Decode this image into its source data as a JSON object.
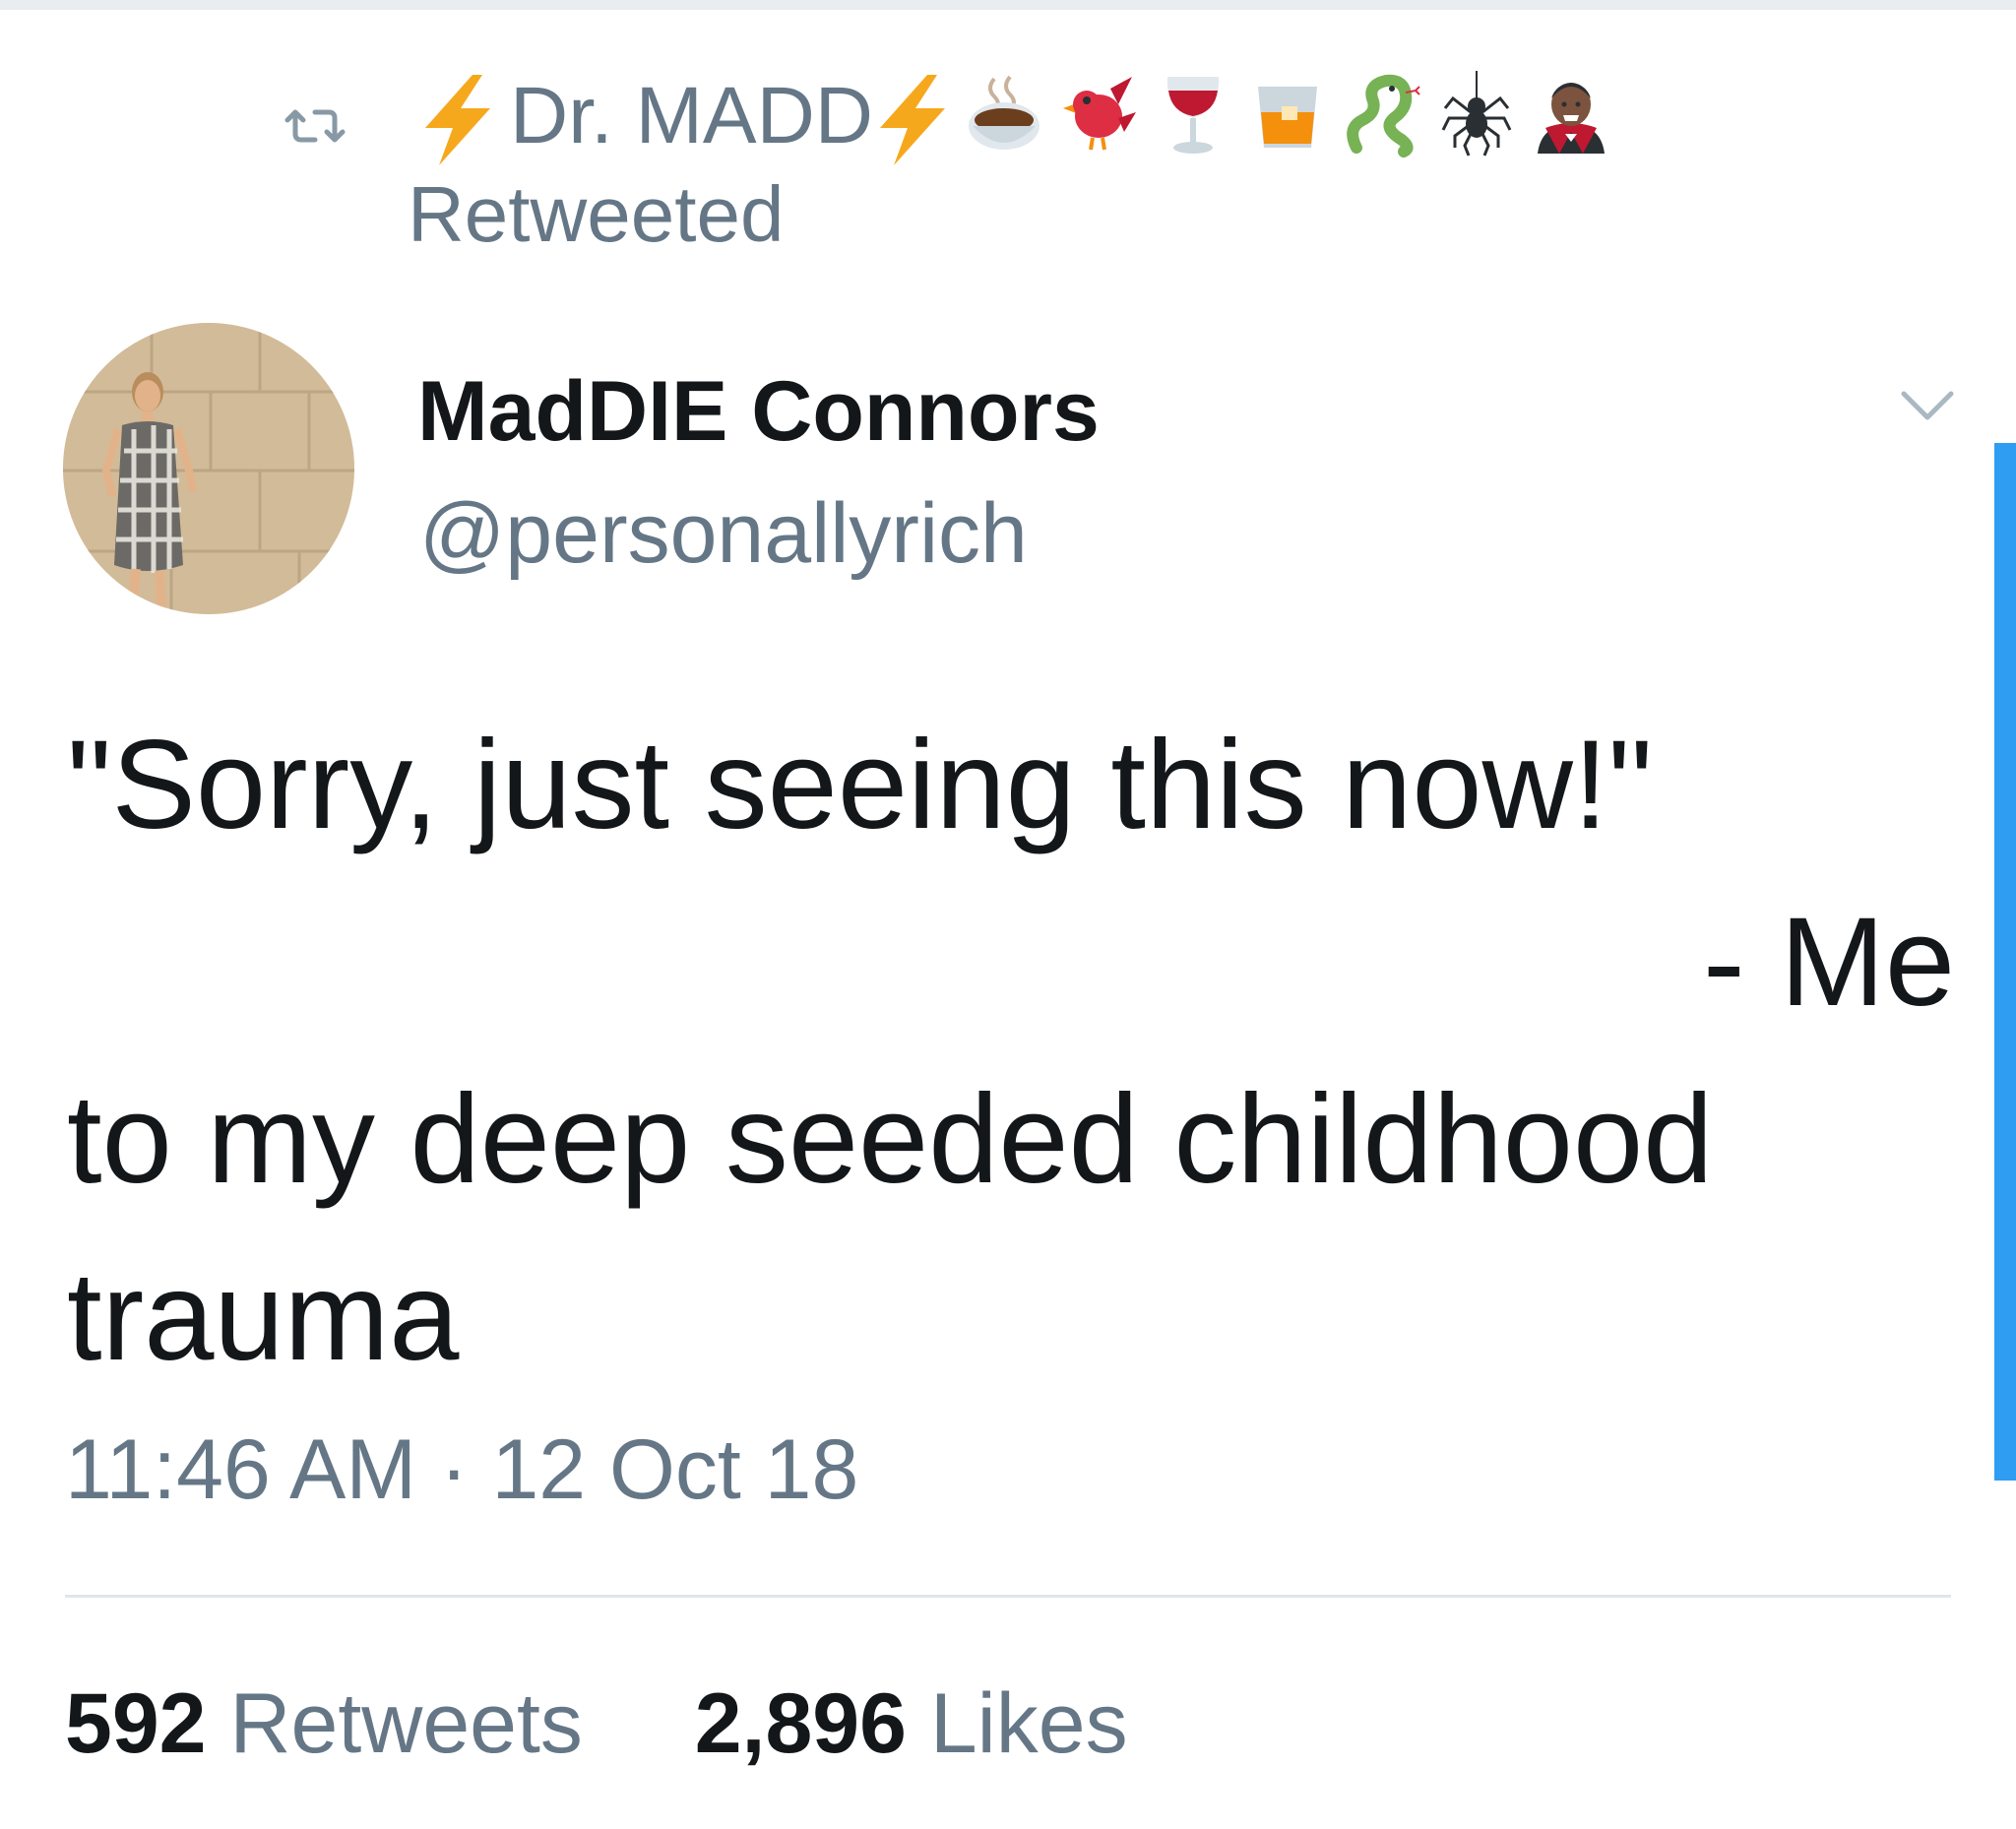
{
  "retweet_context": {
    "icon": "retweet-icon",
    "retweeter_name": "Dr. MADD",
    "name_emojis": [
      "lightning-icon",
      "lightning-icon",
      "coffee-icon",
      "bird-icon",
      "wine-glass-icon",
      "whiskey-glass-icon",
      "snake-icon",
      "spider-icon",
      "vampire-icon"
    ],
    "label": "Retweeted"
  },
  "author": {
    "display_name": "MadDIE Connors",
    "handle": "@personallyrich",
    "avatar": "profile-photo"
  },
  "tweet": {
    "line_1": "\"Sorry, just seeing this now!\"",
    "line_2": "-  Me",
    "line_3": "to my deep seeded childhood",
    "line_4": "trauma"
  },
  "meta": {
    "time": "11:46 AM",
    "separator": "·",
    "date": "12 Oct 18"
  },
  "stats": {
    "retweets_count": "592",
    "retweets_label": "Retweets",
    "likes_count": "2,896",
    "likes_label": "Likes"
  },
  "colors": {
    "text_primary": "#14171a",
    "text_secondary": "#657786",
    "accent": "#2e9df2",
    "bolt": "#f6a81d"
  }
}
